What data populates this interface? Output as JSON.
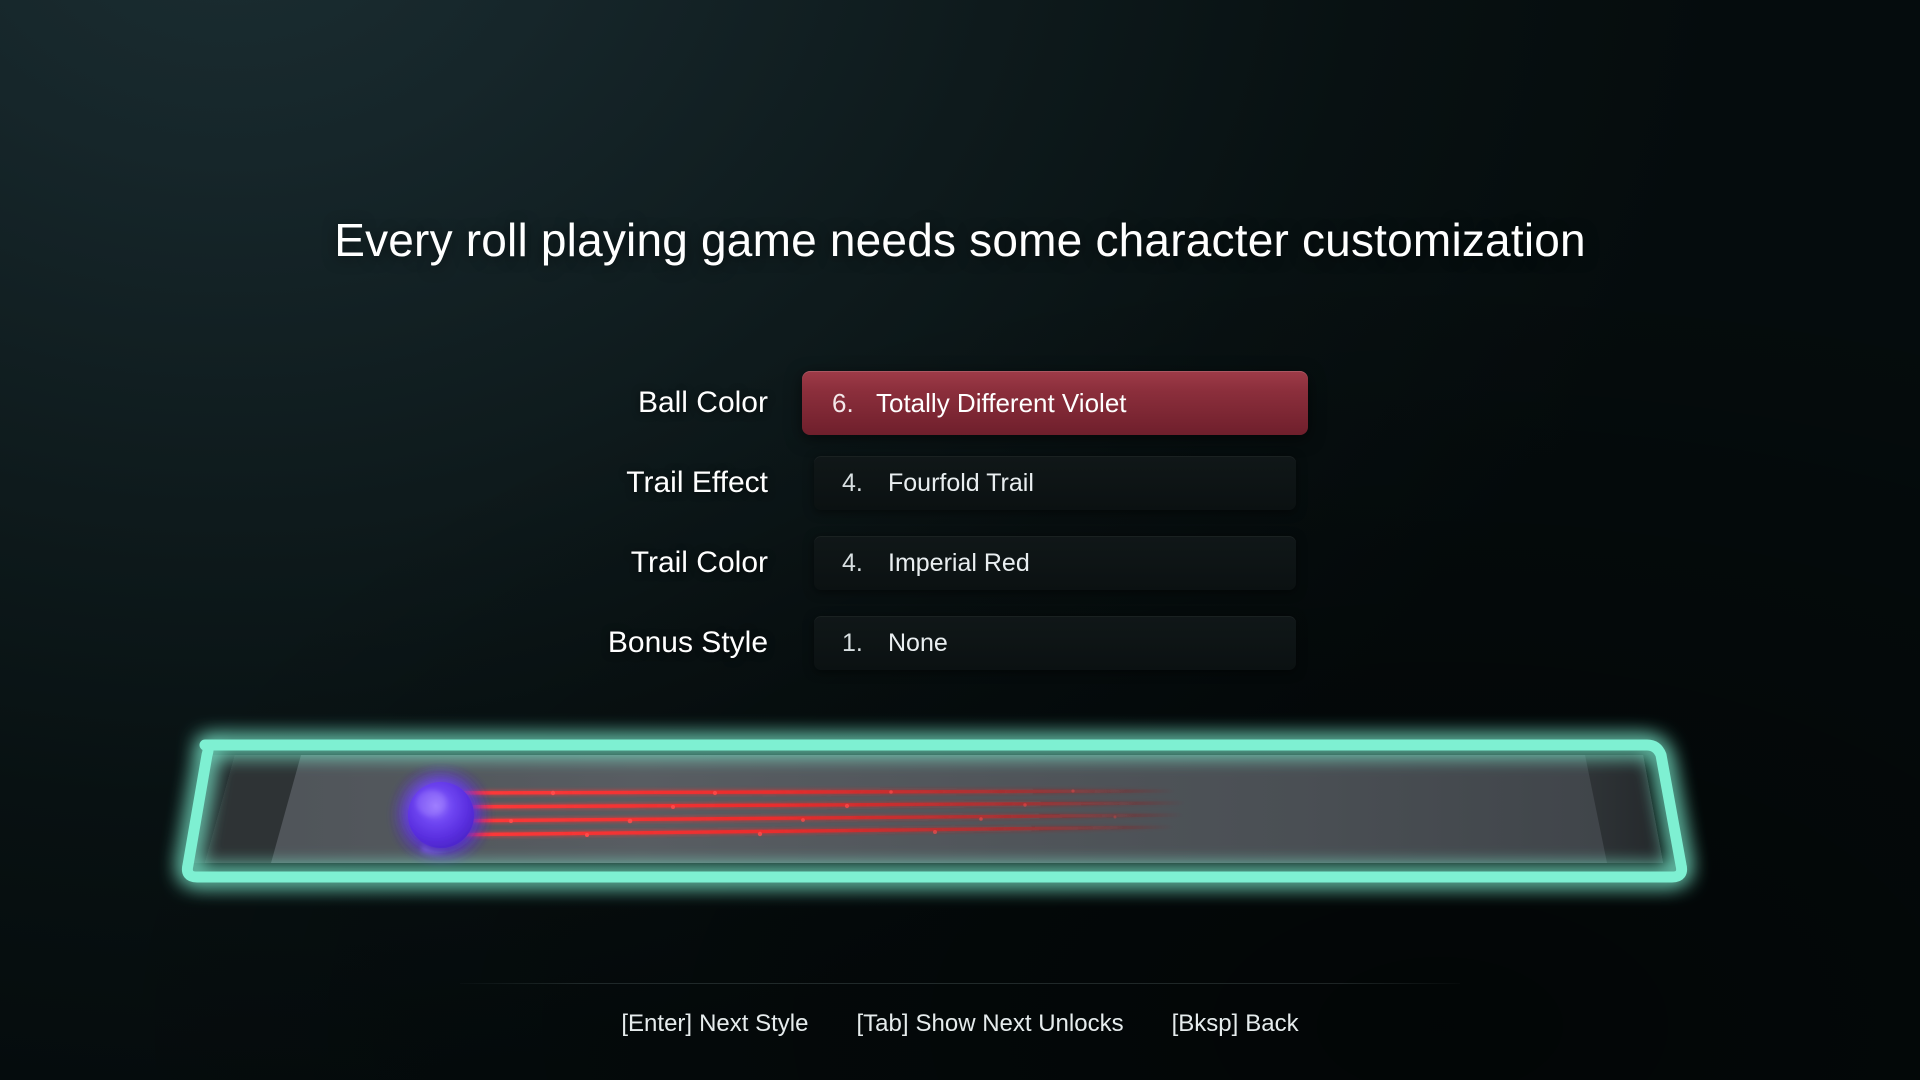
{
  "title": "Every roll playing game needs some character customization",
  "menu": {
    "rows": [
      {
        "label": "Ball Color",
        "index": "6.",
        "value": "Totally Different Violet",
        "selected": true
      },
      {
        "label": "Trail Effect",
        "index": "4.",
        "value": "Fourfold Trail",
        "selected": false
      },
      {
        "label": "Trail Color",
        "index": "4.",
        "value": "Imperial Red",
        "selected": false
      },
      {
        "label": "Bonus Style",
        "index": "1.",
        "value": "None",
        "selected": false
      }
    ]
  },
  "preview": {
    "frame_color": "#7ef0d2",
    "track_surface_color": "#54595e",
    "track_shadow_color": "#2b3033",
    "ball_color": "#6a3cf0",
    "ball_glow_color": "#9a7cff",
    "trail_color": "#f03030",
    "trail_count": 4,
    "ball_label": "Totally Different Violet",
    "trail_label": "Fourfold Trail / Imperial Red"
  },
  "footer": {
    "hints": [
      {
        "key": "[Enter]",
        "action": "Next Style"
      },
      {
        "key": "[Tab]",
        "action": "Show Next Unlocks"
      },
      {
        "key": "[Bksp]",
        "action": "Back"
      }
    ]
  },
  "colors": {
    "background_top_left": "#16262a",
    "background_bottom_right": "#060d0e",
    "selected_row": "#8c2f3c",
    "row": "#0d1314",
    "accent": "#7ef0d2",
    "text": "#ffffff"
  }
}
